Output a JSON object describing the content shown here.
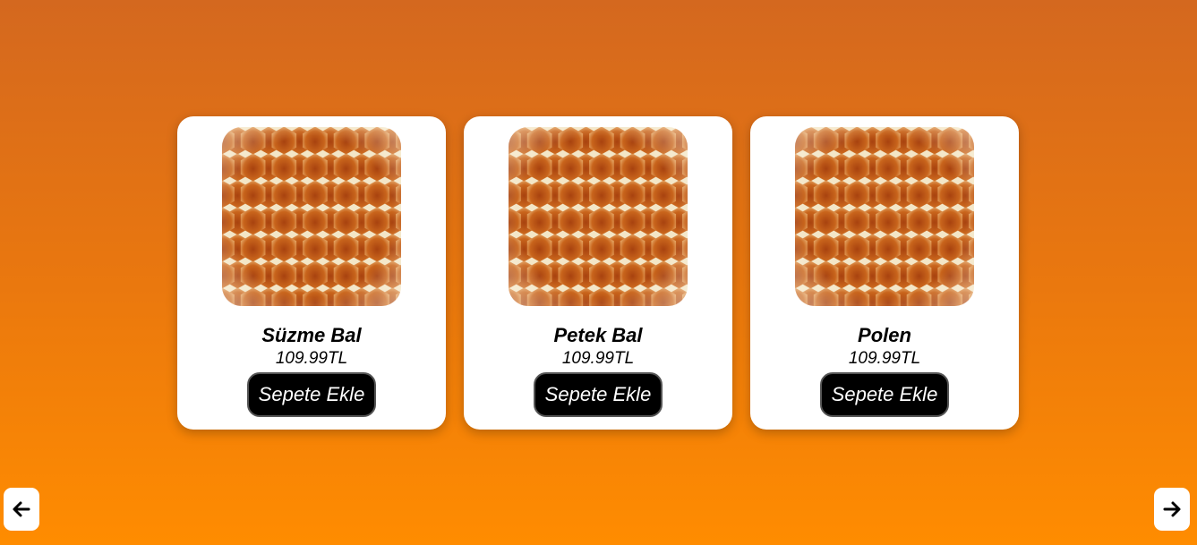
{
  "products": [
    {
      "name": "Süzme Bal",
      "price": "109.99TL",
      "button_label": "Sepete Ekle",
      "image": "honeycomb"
    },
    {
      "name": "Petek Bal",
      "price": "109.99TL",
      "button_label": "Sepete Ekle",
      "image": "honeycomb"
    },
    {
      "name": "Polen",
      "price": "109.99TL",
      "button_label": "Sepete Ekle",
      "image": "honeycomb"
    }
  ],
  "navigation": {
    "prev_icon": "arrow-left-icon",
    "next_icon": "arrow-right-icon"
  },
  "colors": {
    "background_top": "#d4681f",
    "background_bottom": "#ff8c00",
    "card": "#ffffff",
    "button": "#000000"
  }
}
